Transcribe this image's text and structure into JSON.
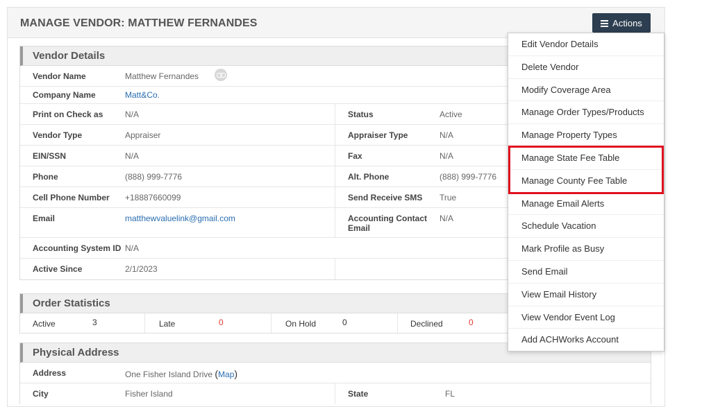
{
  "header": {
    "title": "MANAGE VENDOR: MATTHEW FERNANDES",
    "actions_label": "Actions"
  },
  "vendor_details": {
    "title": "Vendor Details",
    "vendor_name_label": "Vendor Name",
    "vendor_name": "Matthew Fernandes",
    "company_name_label": "Company Name",
    "company_name": "Matt&Co.",
    "print_on_check_label": "Print on Check as",
    "print_on_check": "N/A",
    "status_label": "Status",
    "status": "Active",
    "vendor_type_label": "Vendor Type",
    "vendor_type": "Appraiser",
    "appraiser_type_label": "Appraiser Type",
    "appraiser_type": "N/A",
    "ein_label": "EIN/SSN",
    "ein": "N/A",
    "fax_label": "Fax",
    "fax": "N/A",
    "phone_label": "Phone",
    "phone": "(888) 999-7776",
    "alt_phone_label": "Alt. Phone",
    "alt_phone": "(888) 999-7776",
    "cell_label": "Cell Phone Number",
    "cell": "+18887660099",
    "sms_label": "Send Receive SMS",
    "sms": "True",
    "email_label": "Email",
    "email": "matthewvaluelink@gmail.com",
    "acct_email_label_1": "Accounting Contact",
    "acct_email_label_2": "Email",
    "acct_email": "N/A",
    "acct_system_label": "Accounting System ID",
    "acct_system": "N/A",
    "active_since_label": "Active Since",
    "active_since": "2/1/2023"
  },
  "order_statistics": {
    "title": "Order Statistics",
    "active_label": "Active",
    "active": "3",
    "late_label": "Late",
    "late": "0",
    "on_hold_label": "On Hold",
    "on_hold": "0",
    "declined_label": "Declined",
    "declined": "0"
  },
  "physical_address": {
    "title": "Physical Address",
    "address_label": "Address",
    "address": "One Fisher Island Drive",
    "map_open": "(",
    "map_link": "Map",
    "map_close": ")",
    "city_label": "City",
    "city": "Fisher Island",
    "state_label": "State",
    "state": "FL"
  },
  "actions_menu": [
    "Edit Vendor Details",
    "Delete Vendor",
    "Modify Coverage Area",
    "Manage Order Types/Products",
    "Manage Property Types",
    "Manage State Fee Table",
    "Manage County Fee Table",
    "Manage Email Alerts",
    "Schedule Vacation",
    "Mark Profile as Busy",
    "Send Email",
    "View Email History",
    "View Vendor Event Log",
    "Add ACHWorks Account"
  ],
  "colors": {
    "actions_button": "#2c3e50",
    "link": "#2a6db0",
    "highlight": "#e0101e"
  }
}
